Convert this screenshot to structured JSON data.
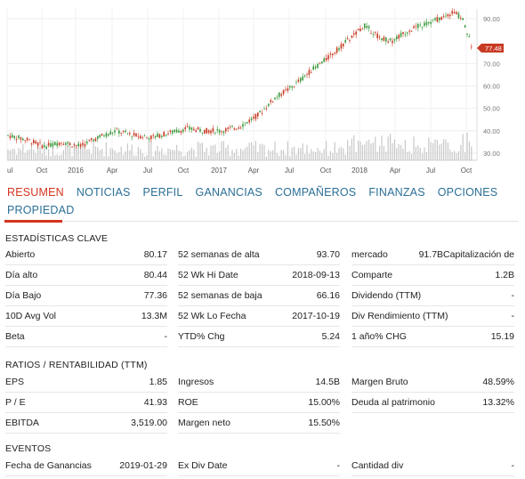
{
  "chart": {
    "y_ticks": [
      "90.00",
      "70.00",
      "60.00",
      "50.00",
      "40.00",
      "30.00"
    ],
    "x_ticks": [
      "ul",
      "Oct",
      "2016",
      "Apr",
      "Jul",
      "Oct",
      "2017",
      "Apr",
      "Jul",
      "Oct",
      "2018",
      "Apr",
      "Jul",
      "Oct"
    ],
    "last_price": "77.48",
    "accent": "#c83a24",
    "up_color": "#3d9a3d",
    "down_color": "#c83a24"
  },
  "tabs": [
    "RESUMEN",
    "NOTICIAS",
    "PERFIL",
    "GANANCIAS",
    "COMPAÑEROS",
    "FINANZAS",
    "OPCIONES",
    "PROPIEDAD"
  ],
  "key_stats": {
    "title": "ESTADÍSTICAS CLAVE",
    "rows": [
      [
        [
          "Abierto",
          "80.17"
        ],
        [
          "52 semanas de alta",
          "93.70"
        ],
        [
          "mercado",
          "91.7BCapitalización de"
        ]
      ],
      [
        [
          "Día alto",
          "80.44"
        ],
        [
          "52 Wk Hi Date",
          "2018-09-13"
        ],
        [
          "Comparte",
          "1.2B"
        ]
      ],
      [
        [
          "Día Bajo",
          "77.36"
        ],
        [
          "52 semanas de baja",
          "66.16"
        ],
        [
          "Dividendo (TTM)",
          "-"
        ]
      ],
      [
        [
          "10D Avg Vol",
          "13.3M"
        ],
        [
          "52 Wk Lo Fecha",
          "2017-10-19"
        ],
        [
          "Div Rendimiento (TTM)",
          "-"
        ]
      ],
      [
        [
          "Beta",
          "-"
        ],
        [
          "YTD% Chg",
          "5.24"
        ],
        [
          "1 año% CHG",
          "15.19"
        ]
      ]
    ]
  },
  "ratios": {
    "title": "RATIOS / RENTABILIDAD (TTM)",
    "rows": [
      [
        [
          "EPS",
          "1.85"
        ],
        [
          "Ingresos",
          "14.5B"
        ],
        [
          "Margen Bruto",
          "48.59%"
        ]
      ],
      [
        [
          "P / E",
          "41.93"
        ],
        [
          "ROE",
          "15.00%"
        ],
        [
          "Deuda al patrimonio",
          "13.32%"
        ]
      ],
      [
        [
          "EBITDA",
          "3,519.00"
        ],
        [
          "Margen neto",
          "15.50%"
        ],
        null
      ]
    ]
  },
  "events": {
    "title": "EVENTOS",
    "rows": [
      [
        [
          "Fecha de Ganancias",
          "2019-01-29"
        ],
        [
          "Ex Div Date",
          "-"
        ],
        [
          "Cantidad div",
          "-"
        ]
      ]
    ]
  }
}
